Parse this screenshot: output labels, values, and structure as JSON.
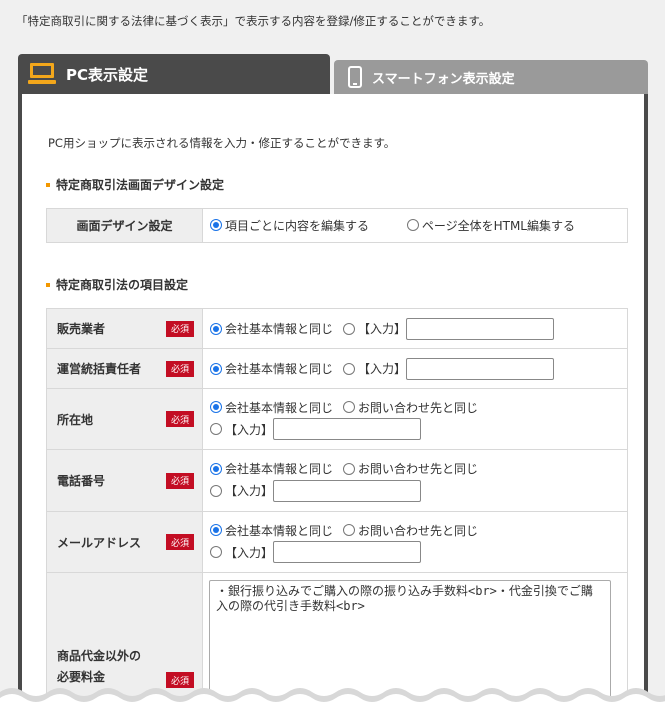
{
  "intro": "「特定商取引に関する法律に基づく表示」で表示する内容を登録/修正することができます。",
  "tabs": {
    "pc": "PC表示設定",
    "smartphone": "スマートフォン表示設定"
  },
  "description": "PC用ショップに表示される情報を入力・修正することができます。",
  "section1": {
    "title": "特定商取引法画面デザイン設定",
    "row_label": "画面デザイン設定",
    "options": [
      "項目ごとに内容を編集する",
      "ページ全体をHTML編集する"
    ],
    "selected": 0
  },
  "section2": {
    "title": "特定商取引法の項目設定",
    "required": "必須",
    "rows": [
      {
        "label": "販売業者",
        "opt1": "会社基本情報と同じ",
        "opt2": "【入力】"
      },
      {
        "label": "運営統括責任者",
        "opt1": "会社基本情報と同じ",
        "opt2": "【入力】"
      },
      {
        "label": "所在地",
        "opt1": "会社基本情報と同じ",
        "opt2": "お問い合わせ先と同じ",
        "opt3": "【入力】"
      },
      {
        "label": "電話番号",
        "opt1": "会社基本情報と同じ",
        "opt2": "お問い合わせ先と同じ",
        "opt3": "【入力】"
      },
      {
        "label": "メールアドレス",
        "opt1": "会社基本情報と同じ",
        "opt2": "お問い合わせ先と同じ",
        "opt3": "【入力】"
      },
      {
        "label1": "商品代金以外の",
        "label2": "必要料金",
        "text": "・銀行振り込みでご購入の際の振り込み手数料<br>・代金引換でご購入の際の代引き手数料<br>"
      }
    ]
  },
  "colors": {
    "accent": "#f39800",
    "required": "#c30d23",
    "tab_active": "#4a4a4a",
    "tab_inactive": "#9a9a9a",
    "radio": "#1a73e8"
  }
}
